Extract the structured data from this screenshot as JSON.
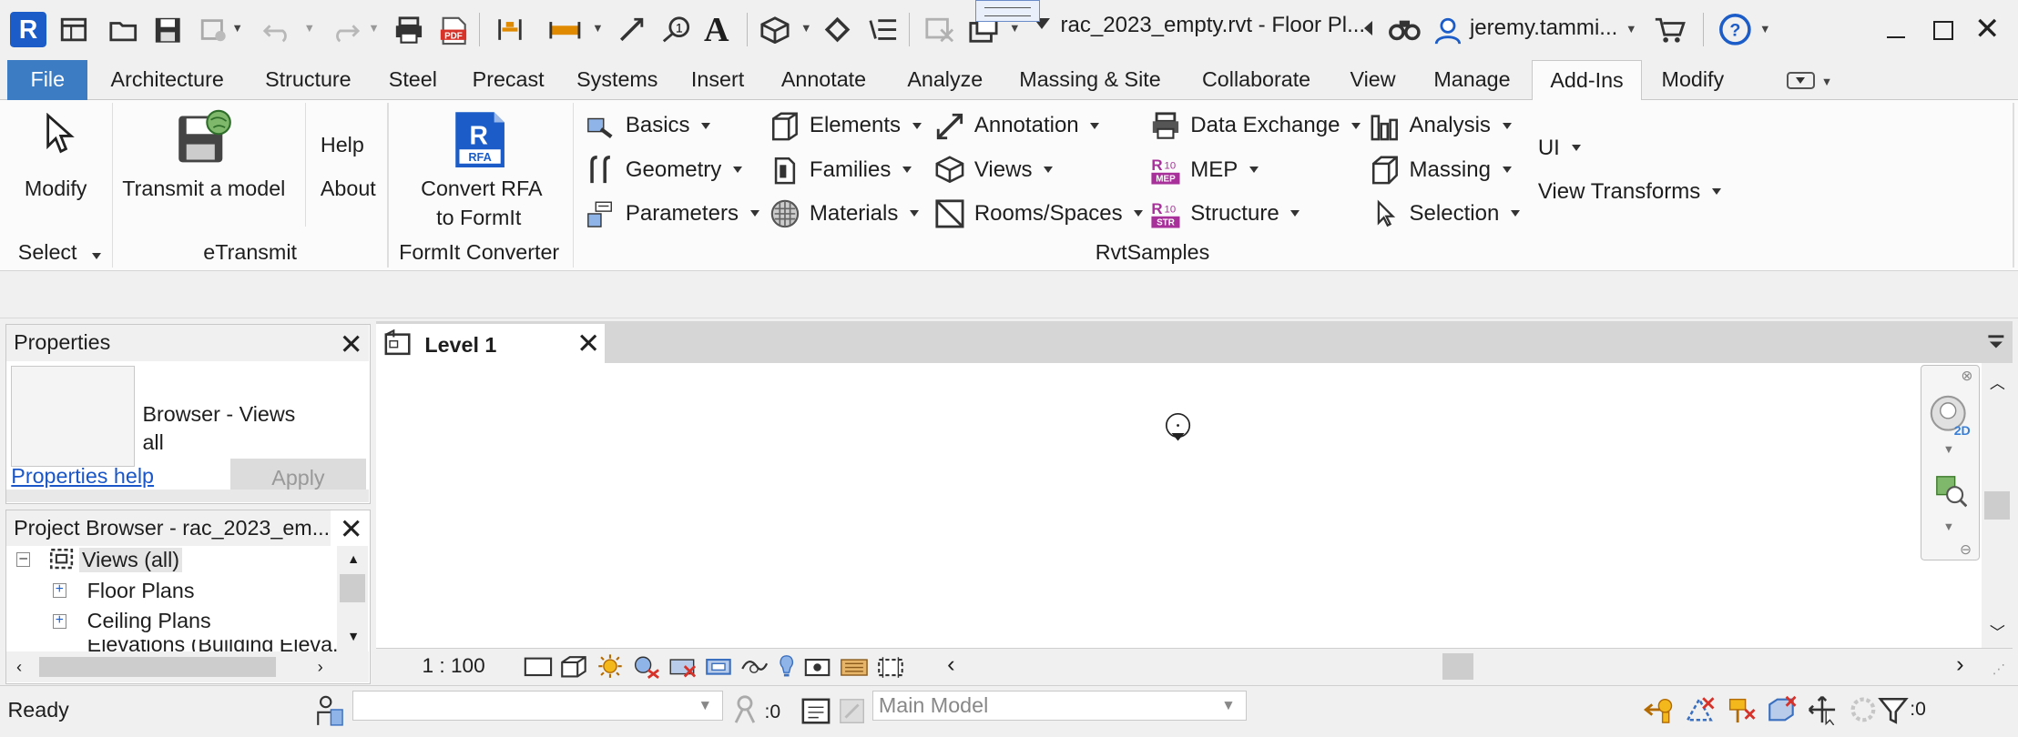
{
  "titlebar": {
    "doc_title": "rac_2023_empty.rvt - Floor Pl...",
    "user": "jeremy.tammi...",
    "app_badge": "R"
  },
  "tabs": [
    {
      "label": "File"
    },
    {
      "label": "Architecture"
    },
    {
      "label": "Structure"
    },
    {
      "label": "Steel"
    },
    {
      "label": "Precast"
    },
    {
      "label": "Systems"
    },
    {
      "label": "Insert"
    },
    {
      "label": "Annotate"
    },
    {
      "label": "Analyze"
    },
    {
      "label": "Massing & Site"
    },
    {
      "label": "Collaborate"
    },
    {
      "label": "View"
    },
    {
      "label": "Manage"
    },
    {
      "label": "Add-Ins"
    },
    {
      "label": "Modify"
    }
  ],
  "ribbon": {
    "select": {
      "modify": "Modify",
      "panel": "Select"
    },
    "etransmit": {
      "transmit": "Transmit a model",
      "help": "Help",
      "about": "About",
      "panel": "eTransmit"
    },
    "formit": {
      "line1": "Convert RFA",
      "line2": "to FormIt",
      "panel": "FormIt Converter",
      "rfa_badge": "RFA"
    },
    "rvtsamples": {
      "panel": "RvtSamples",
      "col1": [
        "Basics",
        "Geometry",
        "Parameters"
      ],
      "col2": [
        "Elements",
        "Families",
        "Materials"
      ],
      "col3": [
        "Annotation",
        "Views",
        "Rooms/Spaces"
      ],
      "col4": [
        "Data Exchange",
        "MEP",
        "Structure"
      ],
      "col5": [
        "Analysis",
        "Massing",
        "Selection"
      ],
      "col6": [
        "UI",
        "View Transforms"
      ]
    }
  },
  "properties": {
    "title": "Properties",
    "type_line1": "Browser - Views",
    "type_line2": "all",
    "help_link": "Properties help",
    "apply": "Apply"
  },
  "project_browser": {
    "title": "Project Browser - rac_2023_em...",
    "root": "Views (all)",
    "items": [
      "Floor Plans",
      "Ceiling Plans",
      "Elevations (Building Eleva..."
    ]
  },
  "view": {
    "tab_label": "Level 1",
    "scale": "1 : 100"
  },
  "status": {
    "text": "Ready",
    "worksets_count": ":0",
    "model": "Main Model",
    "filter_count": ":0"
  },
  "colors": {
    "file_tab": "#3c7cc3",
    "link": "#1a56c8",
    "revit_blue": "#1b5cc8"
  }
}
